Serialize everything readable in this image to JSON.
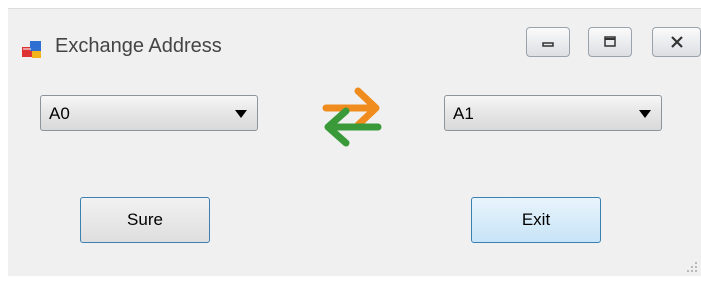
{
  "window": {
    "title": "Exchange Address",
    "caption_buttons": [
      "minimize",
      "maximize",
      "close"
    ]
  },
  "source_combo": {
    "value": "A0",
    "icon": "dropdown-arrow-icon"
  },
  "swap_icon": {
    "name": "exchange-arrows-icon",
    "colors": {
      "top_arrow": "#f08c1e",
      "bottom_arrow": "#3a9a3a"
    }
  },
  "target_combo": {
    "value": "A1",
    "icon": "dropdown-arrow-icon"
  },
  "buttons": {
    "sure_label": "Sure",
    "exit_label": "Exit"
  },
  "colors": {
    "window_bg": "#f0f0f0",
    "button_border": "#3c7fb1"
  }
}
